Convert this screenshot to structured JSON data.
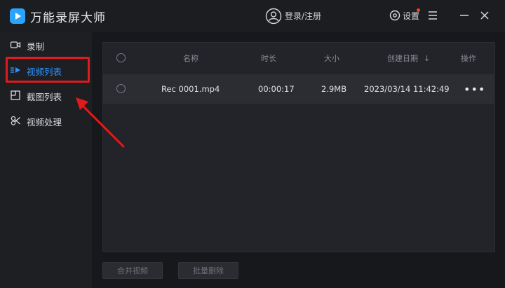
{
  "app": {
    "title": "万能录屏大师"
  },
  "header": {
    "login_label": "登录/注册",
    "settings_label": "设置"
  },
  "sidebar": {
    "items": [
      {
        "label": "录制",
        "icon": "camera-icon",
        "active": false
      },
      {
        "label": "视频列表",
        "icon": "video-list-icon",
        "active": true
      },
      {
        "label": "截图列表",
        "icon": "screenshot-icon",
        "active": false
      },
      {
        "label": "视频处理",
        "icon": "video-process-icon",
        "active": false
      }
    ]
  },
  "table": {
    "columns": [
      "名称",
      "时长",
      "大小",
      "创建日期",
      "操作"
    ],
    "sort_indicator": "↓",
    "rows": [
      {
        "name": "Rec 0001.mp4",
        "duration": "00:00:17",
        "size": "2.9MB",
        "created": "2023/03/14 11:42:49",
        "action": "•••"
      }
    ]
  },
  "footer": {
    "merge_label": "合并视频",
    "batch_delete_label": "批量删除"
  },
  "colors": {
    "accent": "#2f93ff",
    "highlight": "#e01b1b",
    "logo": "#2aa3ff"
  }
}
